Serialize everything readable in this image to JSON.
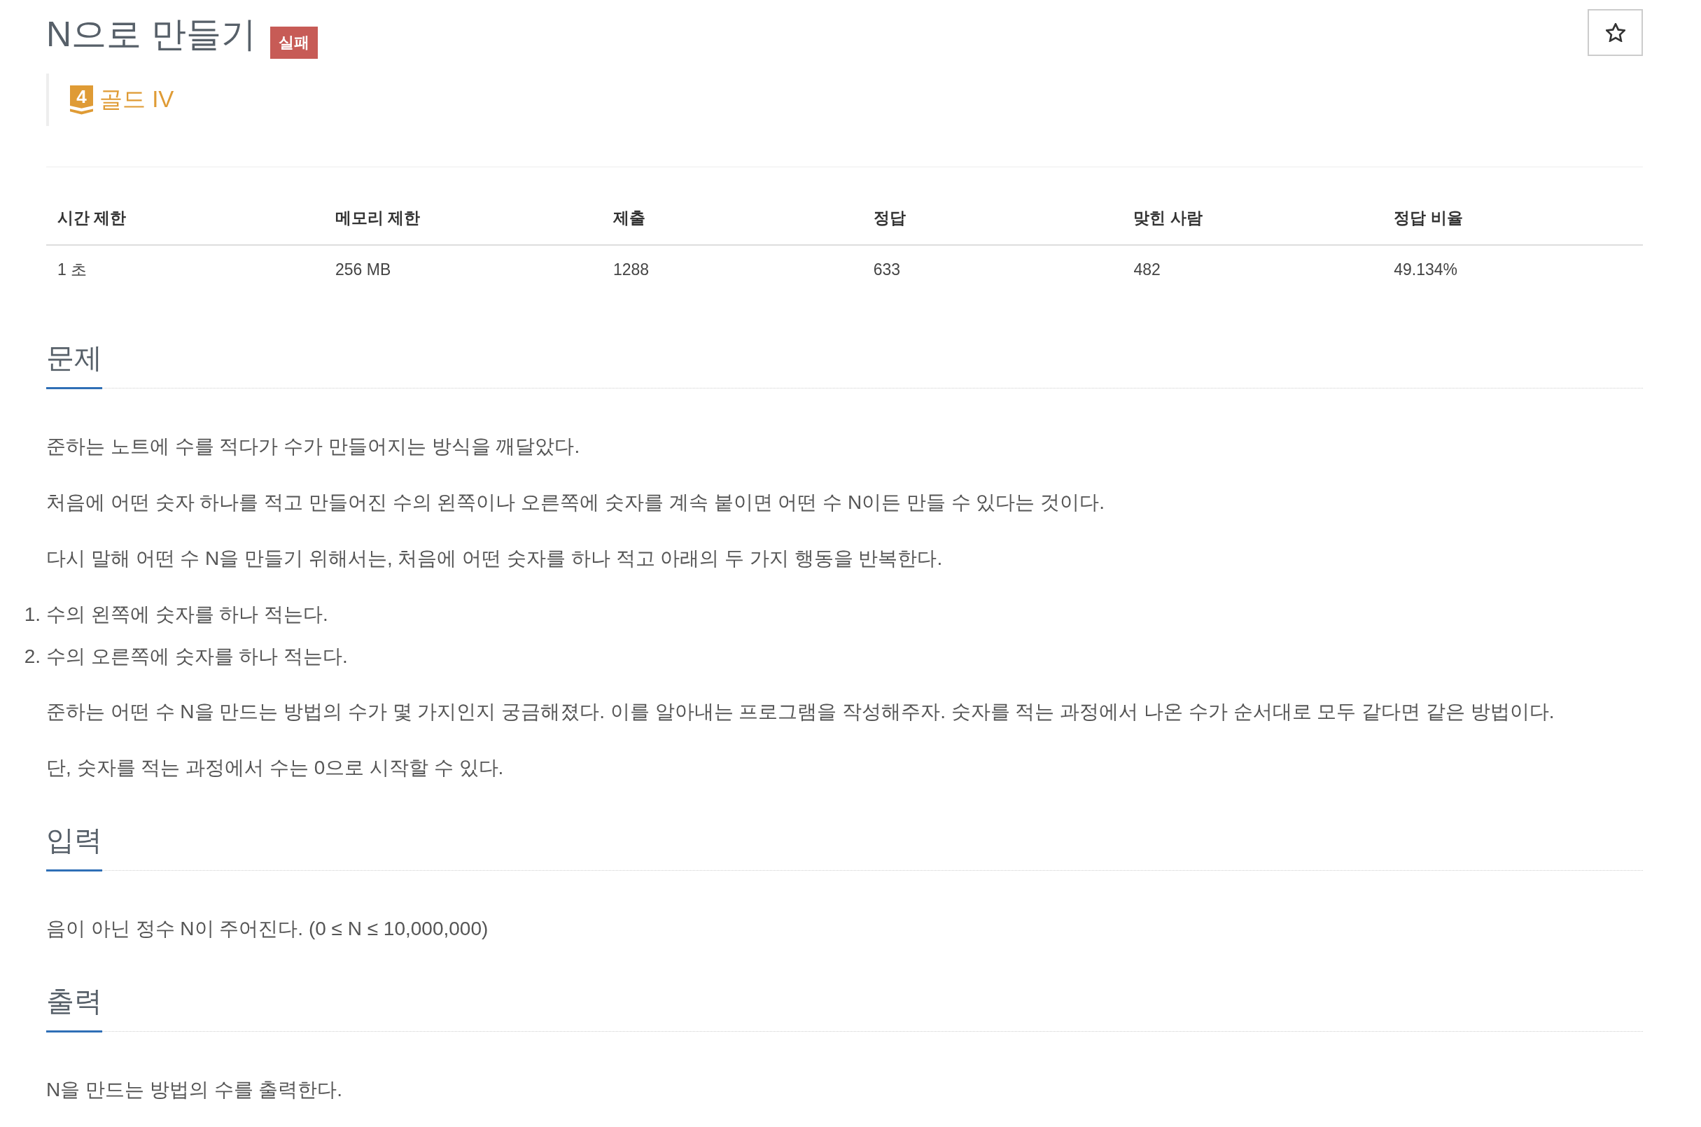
{
  "header": {
    "title": "N으로 만들기",
    "result_badge": "실패",
    "favorite_button": {
      "starred": false
    }
  },
  "tier": {
    "number": "4",
    "label": "골드 IV"
  },
  "limits_table": {
    "columns": [
      "시간 제한",
      "메모리 제한",
      "제출",
      "정답",
      "맞힌 사람",
      "정답 비율"
    ],
    "rows": [
      [
        "1 초",
        "256 MB",
        "1288",
        "633",
        "482",
        "49.134%"
      ]
    ]
  },
  "sections": [
    {
      "heading": "문제",
      "blocks": [
        {
          "kind": "paragraph",
          "text": "준하는 노트에 수를 적다가 수가 만들어지는 방식을 깨달았다."
        },
        {
          "kind": "paragraph",
          "text": "처음에 어떤 숫자 하나를 적고 만들어진 수의 왼쪽이나 오른쪽에 숫자를 계속 붙이면 어떤 수 N이든 만들 수 있다는 것이다."
        },
        {
          "kind": "paragraph",
          "text": "다시 말해 어떤 수 N을 만들기 위해서는, 처음에 어떤 숫자를 하나 적고 아래의 두 가지 행동을 반복한다."
        },
        {
          "kind": "ordered_list",
          "items": [
            {
              "number": "1.",
              "text": "수의 왼쪽에 숫자를 하나 적는다."
            },
            {
              "number": "2.",
              "text": "수의 오른쪽에 숫자를 하나 적는다."
            }
          ]
        },
        {
          "kind": "paragraph",
          "text": "준하는 어떤 수 N을 만드는 방법의 수가 몇 가지인지 궁금해졌다. 이를 알아내는 프로그램을 작성해주자. 숫자를 적는 과정에서 나온 수가 순서대로 모두 같다면 같은 방법이다."
        },
        {
          "kind": "paragraph",
          "text": "단, 숫자를 적는 과정에서 수는 0으로 시작할 수 있다."
        }
      ]
    },
    {
      "heading": "입력",
      "blocks": [
        {
          "kind": "paragraph",
          "text": "음이 아닌 정수 N이 주어진다. (0 ≤ N ≤ 10,000,000)"
        }
      ]
    },
    {
      "heading": "출력",
      "blocks": [
        {
          "kind": "paragraph",
          "text": "N을 만드는 방법의 수를 출력한다."
        }
      ]
    }
  ]
}
